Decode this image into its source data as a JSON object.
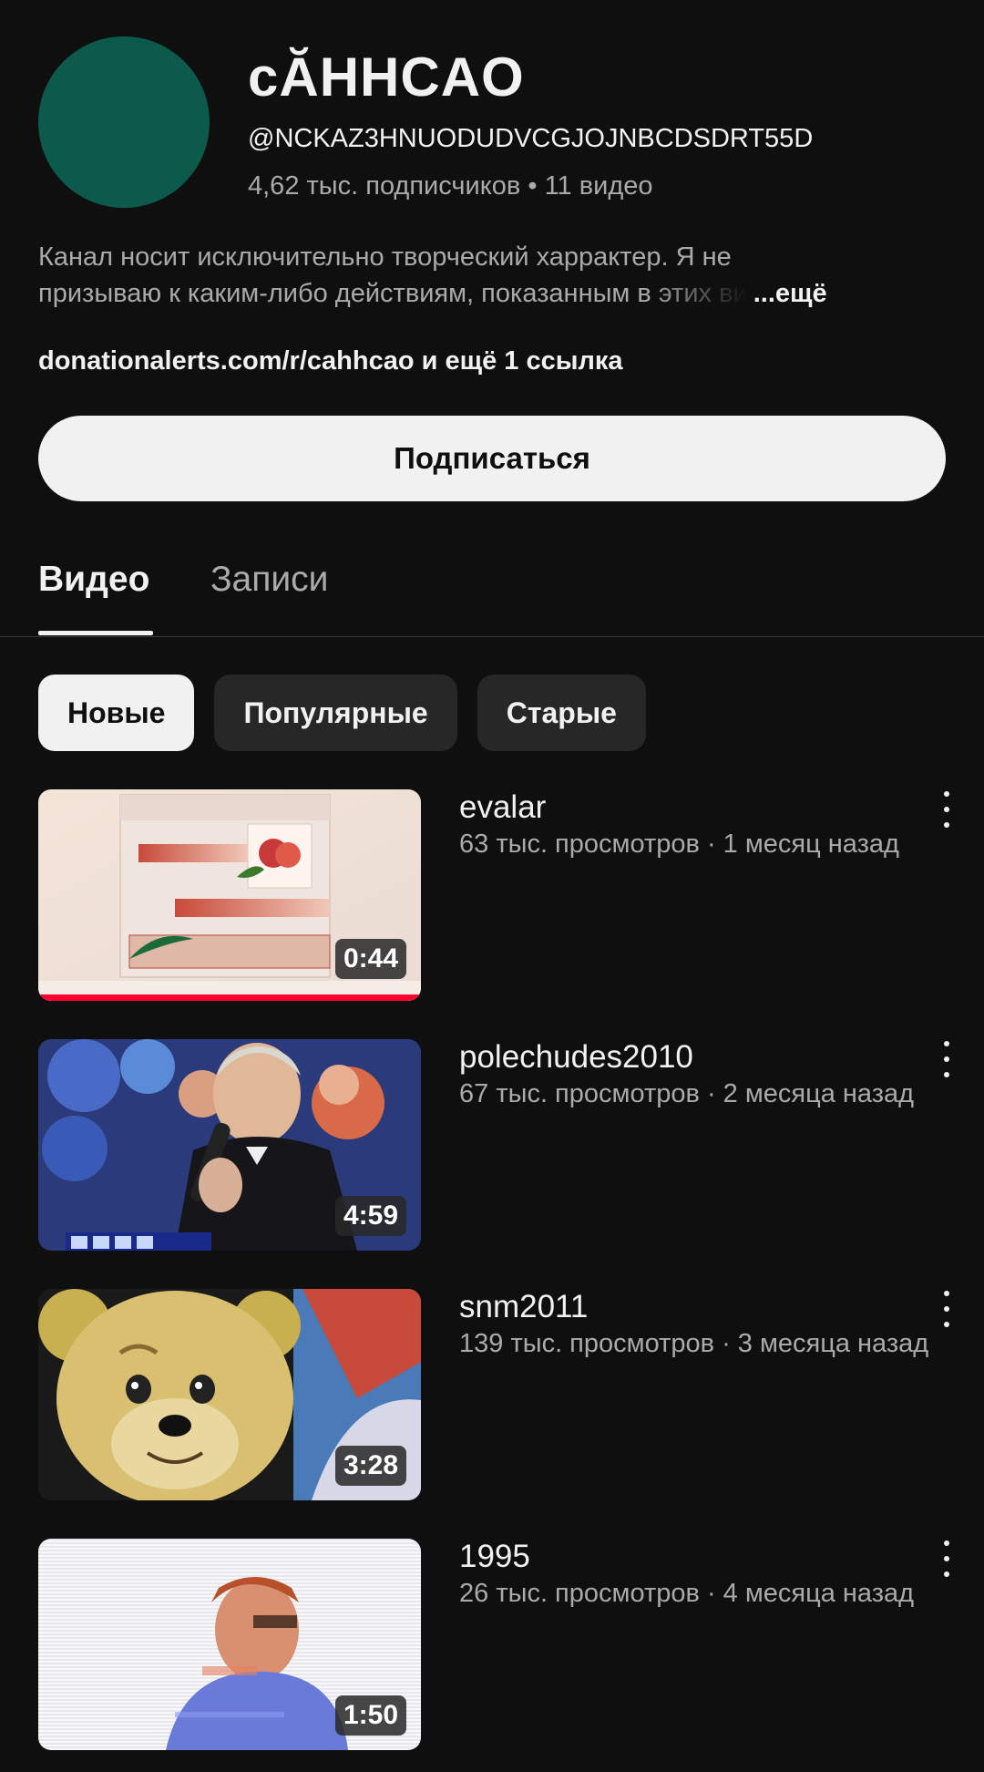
{
  "channel": {
    "name": "cĂHHCAO",
    "handle": "@NCKAZ3HNUODUDVCGJOJNBCDSDRT55D",
    "subscribers": "4,62 тыс. подписчиков",
    "dot": "•",
    "videos_count": "11 видео",
    "avatar_color": "#0b5a4b",
    "description_line1": "Канал носит исключительно творческий харрактер. Я не",
    "description_line2": "призываю к каким-либо действиям, показанным в этих ви",
    "more_label": "...ещё",
    "link_text": "donationalerts.com/r/cahhcao",
    "links_more": "и ещё 1 ссылка",
    "subscribe_label": "Подписаться"
  },
  "tabs": [
    {
      "label": "Видео",
      "active": true
    },
    {
      "label": "Записи",
      "active": false
    }
  ],
  "chips": [
    {
      "label": "Новые",
      "active": true
    },
    {
      "label": "Популярные",
      "active": false
    },
    {
      "label": "Старые",
      "active": false
    }
  ],
  "videos": [
    {
      "title": "evalar",
      "meta": "63 тыс. просмотров · 1 месяц назад",
      "duration": "0:44",
      "watched_fraction": 1.0,
      "menu_icon": "more-vert-icon"
    },
    {
      "title": "polechudes2010",
      "meta": "67 тыс. просмотров · 2 месяца назад",
      "duration": "4:59",
      "menu_icon": "more-vert-icon"
    },
    {
      "title": "snm2011",
      "meta": "139 тыс. просмотров · 3 месяца назад",
      "duration": "3:28",
      "menu_icon": "more-vert-icon"
    },
    {
      "title": "1995",
      "meta": "26 тыс. просмотров · 4 месяца назад",
      "duration": "1:50",
      "menu_icon": "more-vert-icon"
    }
  ],
  "colors": {
    "background": "#0f0f0f",
    "accent_progress": "#ff0033",
    "secondary_text": "#aaaaaa"
  }
}
